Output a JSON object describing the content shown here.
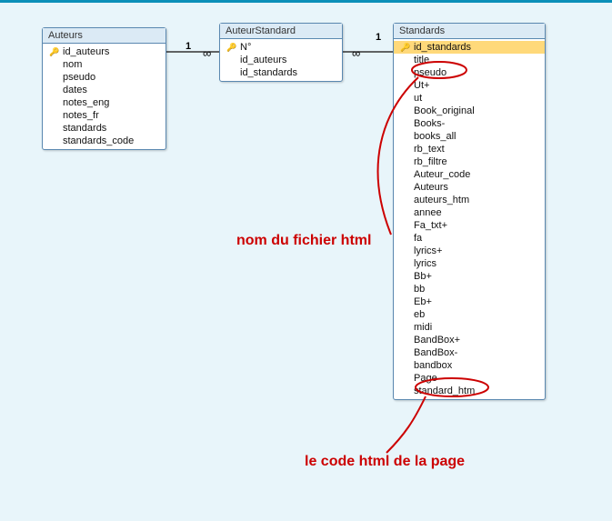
{
  "tables": {
    "auteurs": {
      "title": "Auteurs",
      "fields": [
        {
          "label": "id_auteurs",
          "pk": true
        },
        {
          "label": "nom"
        },
        {
          "label": "pseudo"
        },
        {
          "label": "dates"
        },
        {
          "label": "notes_eng"
        },
        {
          "label": "notes_fr"
        },
        {
          "label": "standards"
        },
        {
          "label": "standards_code"
        }
      ]
    },
    "auteurStandard": {
      "title": "AuteurStandard",
      "fields": [
        {
          "label": "N°",
          "pk": true
        },
        {
          "label": "id_auteurs"
        },
        {
          "label": "id_standards"
        }
      ]
    },
    "standards": {
      "title": "Standards",
      "fields": [
        {
          "label": "id_standards",
          "pk": true,
          "selected": true
        },
        {
          "label": "title"
        },
        {
          "label": "pseudo"
        },
        {
          "label": "Ut+"
        },
        {
          "label": "ut"
        },
        {
          "label": "Book_original"
        },
        {
          "label": "Books-"
        },
        {
          "label": "books_all"
        },
        {
          "label": "rb_text"
        },
        {
          "label": "rb_filtre"
        },
        {
          "label": "Auteur_code"
        },
        {
          "label": "Auteurs"
        },
        {
          "label": "auteurs_htm"
        },
        {
          "label": "annee"
        },
        {
          "label": "Fa_txt+"
        },
        {
          "label": "fa"
        },
        {
          "label": "lyrics+"
        },
        {
          "label": "lyrics"
        },
        {
          "label": "Bb+"
        },
        {
          "label": "bb"
        },
        {
          "label": "Eb+"
        },
        {
          "label": "eb"
        },
        {
          "label": "midi"
        },
        {
          "label": "BandBox+"
        },
        {
          "label": "BandBox-"
        },
        {
          "label": "bandbox"
        },
        {
          "label": "Page"
        },
        {
          "label": "standard_htm"
        }
      ]
    }
  },
  "annotations": {
    "note1": "nom du fichier html",
    "note2": "le code html de la page"
  },
  "relationships": {
    "one_a": "1",
    "one_b": "1"
  }
}
